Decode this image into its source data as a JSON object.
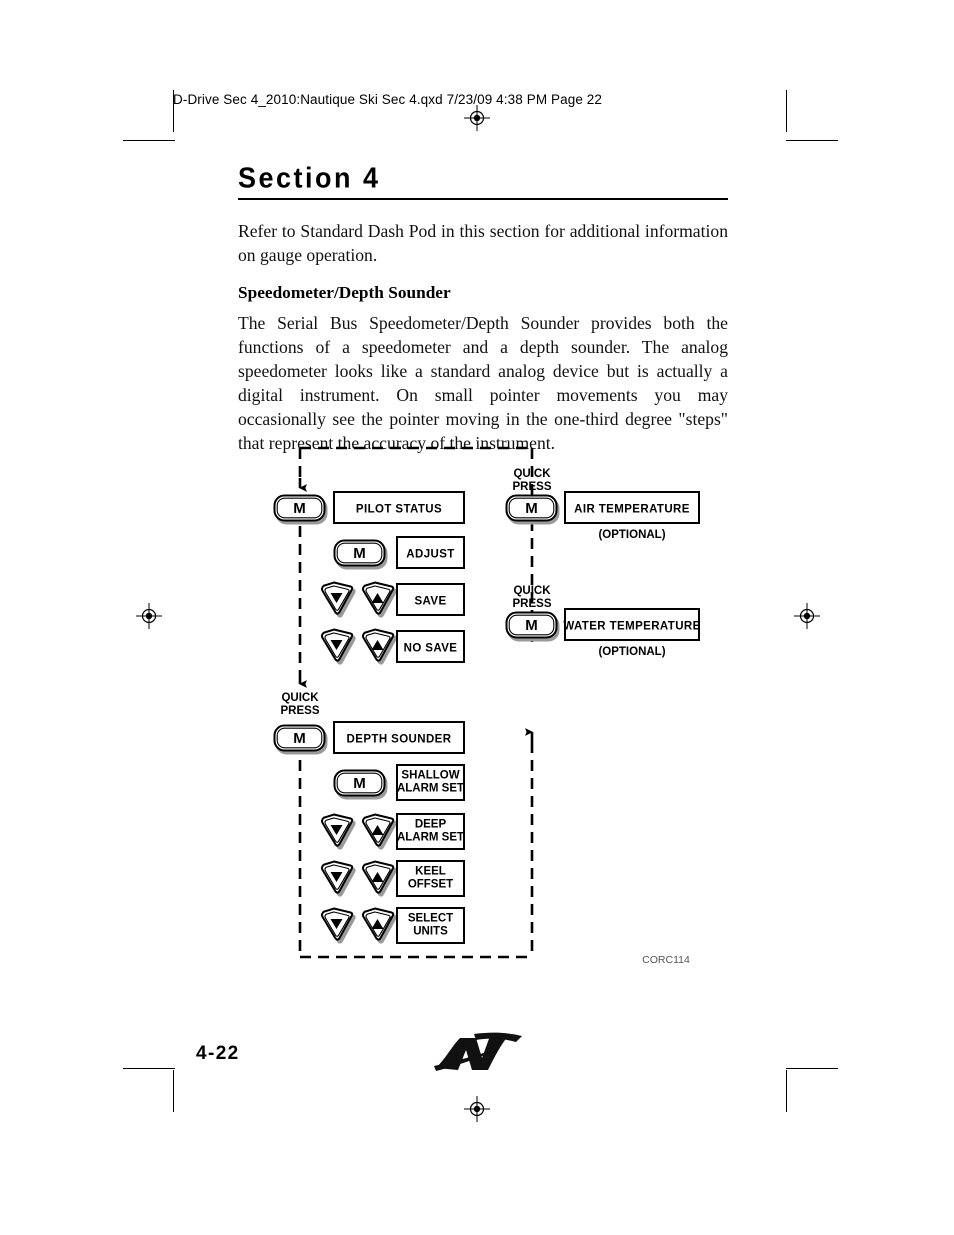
{
  "prepress": {
    "slug": "D-Drive Sec 4_2010:Nautique Ski Sec 4.qxd  7/23/09  4:38 PM  Page 22"
  },
  "header": {
    "section_title": "Section 4"
  },
  "body": {
    "intro_paragraph": "Refer to Standard Dash Pod in this section for additional information on gauge operation.",
    "subheading": "Speedometer/Depth Sounder",
    "description_paragraph": "The Serial Bus Speedometer/Depth Sounder provides both the functions of a speedometer and a depth sounder. The analog speedometer looks like a standard analog device but is actually a digital instrument. On small pointer movements you may occasionally see the pointer moving in the one-third degree \"steps\" that represent the accuracy of the instrument."
  },
  "diagram": {
    "figure_id": "CORC114",
    "quick_press_label_line1": "QUICK",
    "quick_press_label_line2": "PRESS",
    "optional_label": "(OPTIONAL)",
    "mode_button_label": "M",
    "left_column": {
      "quick_press_notes": [
        {
          "id": "qp-depth",
          "line1": "QUICK",
          "line2": "PRESS"
        }
      ],
      "groups": [
        {
          "name": "pilot-status-group",
          "header_button": "M",
          "header_label": "PILOT STATUS",
          "rows": [
            {
              "control": "mode",
              "label": "ADJUST"
            },
            {
              "control": "arrows",
              "label": "SAVE"
            },
            {
              "control": "arrows",
              "label": "NO SAVE"
            }
          ]
        },
        {
          "name": "depth-sounder-group",
          "header_button": "M",
          "header_label": "DEPTH SOUNDER",
          "rows": [
            {
              "control": "mode",
              "label": "SHALLOW ALARM SET",
              "line1": "SHALLOW",
              "line2": "ALARM SET"
            },
            {
              "control": "arrows",
              "label": "DEEP ALARM SET",
              "line1": "DEEP",
              "line2": "ALARM SET"
            },
            {
              "control": "arrows",
              "label": "KEEL OFFSET",
              "line1": "KEEL",
              "line2": "OFFSET"
            },
            {
              "control": "arrows",
              "label": "SELECT UNITS",
              "line1": "SELECT",
              "line2": "UNITS"
            }
          ]
        }
      ]
    },
    "right_column": {
      "groups": [
        {
          "name": "air-temperature-group",
          "quick_press_line1": "QUICK",
          "quick_press_line2": "PRESS",
          "header_button": "M",
          "header_label": "AIR TEMPERATURE",
          "optional": "(OPTIONAL)"
        },
        {
          "name": "water-temperature-group",
          "quick_press_line1": "QUICK",
          "quick_press_line2": "PRESS",
          "header_button": "M",
          "header_label": "WATER TEMPERATURE",
          "optional": "(OPTIONAL)"
        }
      ]
    }
  },
  "footer": {
    "page_number": "4-22",
    "logo_name": "nautique-n-logo"
  },
  "colors": {
    "ink": "#000000",
    "page": "#ffffff",
    "button_shadow": "#9a9a9a"
  }
}
